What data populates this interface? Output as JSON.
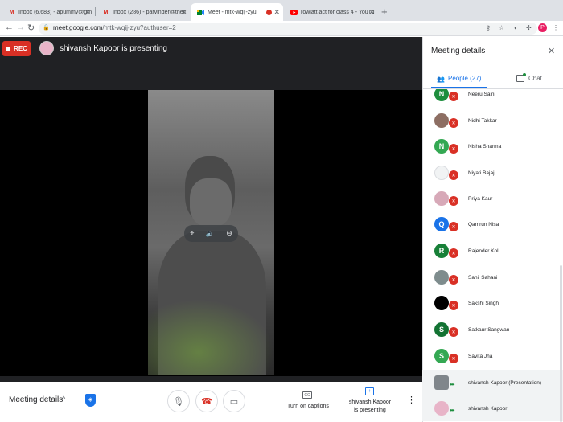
{
  "browser": {
    "tabs": [
      {
        "label": "Inbox (6,683) - apummy@gm",
        "icon": "gmail-icon"
      },
      {
        "label": "Inbox (286) - parvinder@theit",
        "icon": "gmail-icon"
      },
      {
        "label": "Meet - mtk-wqij-zyu",
        "icon": "meet-icon"
      },
      {
        "label": "rowlatt act for class 4 - YouTu",
        "icon": "youtube-icon"
      }
    ],
    "url_host": "meet.google.com",
    "url_path": "/mtk-wqij-zyu?authuser=2",
    "profile_initial": "P"
  },
  "meeting": {
    "rec_label": "REC",
    "presenter_title": "shivansh Kapoor is presenting",
    "details_label": "Meeting details",
    "captions_label": "Turn on captions",
    "captions_icon_text": "CC",
    "presenting_label_1": "shivansh Kapoor",
    "presenting_label_2": "is presenting"
  },
  "panel": {
    "title": "Meeting details",
    "people_tab": "People (27)",
    "chat_tab": "Chat",
    "participants": [
      {
        "name": "Neeru Saini",
        "initial": "N",
        "color": "#1e8e3e"
      },
      {
        "name": "Nidhi Takkar",
        "initial": "",
        "color": "#8d6e63"
      },
      {
        "name": "Nisha Sharma",
        "initial": "N",
        "color": "#34a853"
      },
      {
        "name": "Niyati Bajaj",
        "initial": "",
        "color": "#f1f3f4"
      },
      {
        "name": "Priya Kaur",
        "initial": "",
        "color": "#d7a9b8"
      },
      {
        "name": "Qamrun Nisa",
        "initial": "Q",
        "color": "#1a73e8"
      },
      {
        "name": "Rajender Koli",
        "initial": "R",
        "color": "#188038"
      },
      {
        "name": "Sahil Sahani",
        "initial": "",
        "color": "#7e8c8d"
      },
      {
        "name": "Sakshi Singh",
        "initial": "",
        "color": "#000000"
      },
      {
        "name": "Satkaur Sangwan",
        "initial": "S",
        "color": "#137333"
      },
      {
        "name": "Savita Jha",
        "initial": "S",
        "color": "#34a853"
      },
      {
        "name": "shivansh Kapoor (Presentation)",
        "initial": "",
        "color": "#80868b"
      },
      {
        "name": "shivansh Kapoor",
        "initial": "",
        "color": "#e8b4c8"
      }
    ]
  }
}
